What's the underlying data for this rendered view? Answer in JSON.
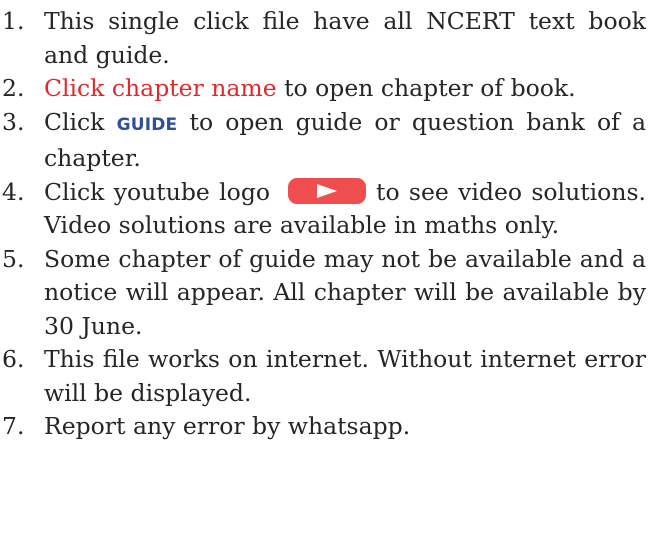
{
  "colors": {
    "text": "#262626",
    "link": "#e0292f",
    "guide": "#2d4f9e",
    "youtube": "#f04e4e"
  },
  "items": [
    {
      "num": "1.",
      "text": "This single click file have all NCERT text book and guide."
    },
    {
      "num": "2.",
      "link": "Click chapter name",
      "after": " to open chapter of book."
    },
    {
      "num": "3.",
      "before": "Click ",
      "guide": "GUIDE",
      "after": " to open guide or question bank of a chapter."
    },
    {
      "num": "4.",
      "before": "Click youtube logo",
      "icon": "youtube-play-icon",
      "after": "to see video solutions. Video solutions are available in maths only."
    },
    {
      "num": "5.",
      "text": "Some chapter of guide may not be available and a notice will appear. All chapter will be available by 30 June."
    },
    {
      "num": "6.",
      "text": "This file works on internet. Without internet error will be displayed."
    },
    {
      "num": "7.",
      "text": "Report any error by whatsapp."
    }
  ]
}
